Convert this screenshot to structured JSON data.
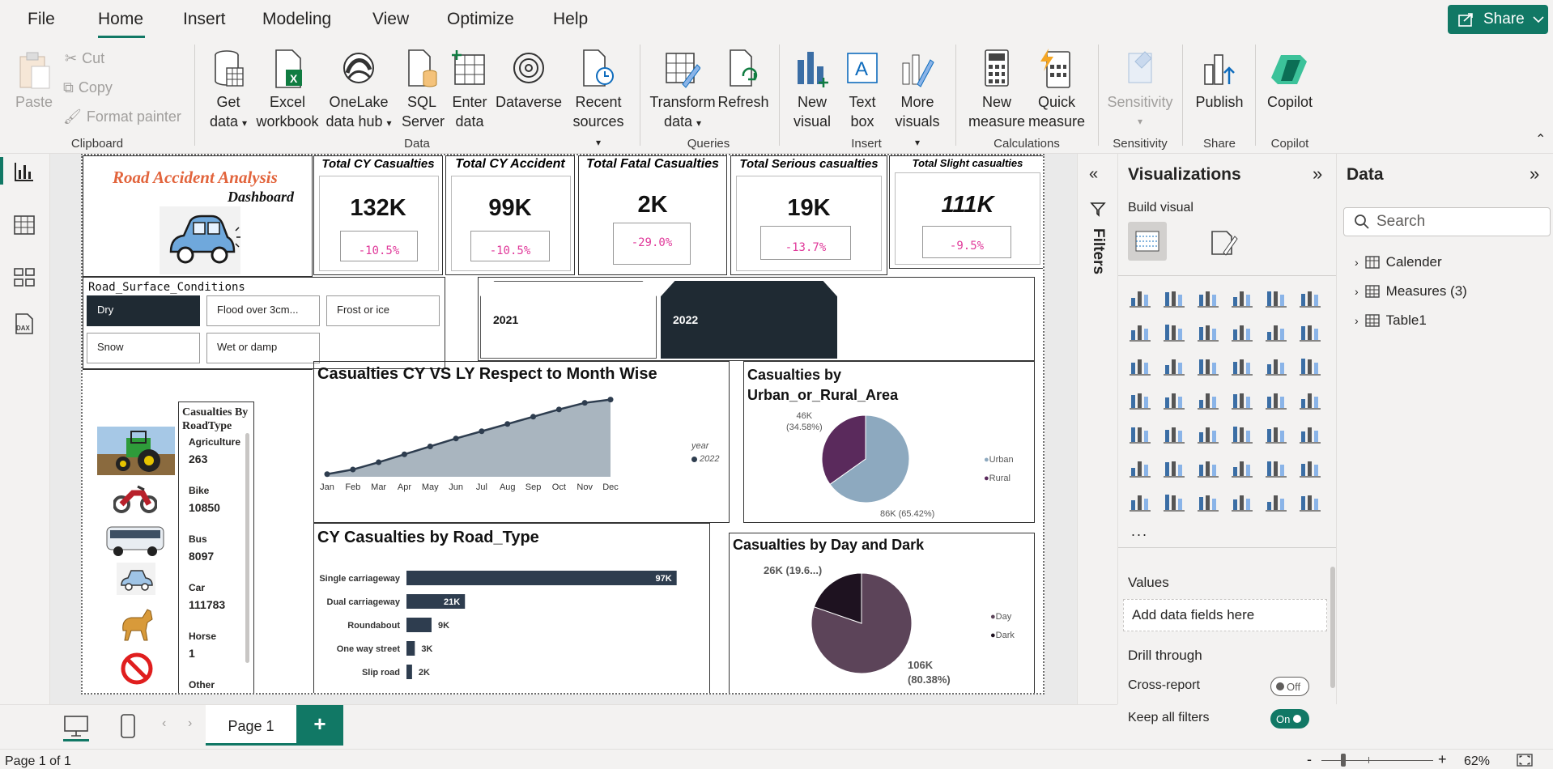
{
  "menu": {
    "file": "File",
    "home": "Home",
    "insert": "Insert",
    "modeling": "Modeling",
    "view": "View",
    "optimize": "Optimize",
    "help": "Help",
    "share": "Share"
  },
  "ribbon": {
    "paste": "Paste",
    "cut": "Cut",
    "copy": "Copy",
    "format_painter": "Format painter",
    "get_data": [
      "Get",
      "data"
    ],
    "excel": [
      "Excel",
      "workbook"
    ],
    "onelake": [
      "OneLake",
      "data hub"
    ],
    "sql": [
      "SQL",
      "Server"
    ],
    "enter_data": [
      "Enter",
      "data"
    ],
    "dataverse": "Dataverse",
    "recent_sources": [
      "Recent",
      "sources"
    ],
    "transform_data": [
      "Transform",
      "data"
    ],
    "refresh": "Refresh",
    "new_visual": [
      "New",
      "visual"
    ],
    "text_box": [
      "Text",
      "box"
    ],
    "more_visuals": [
      "More",
      "visuals"
    ],
    "new_measure": [
      "New",
      "measure"
    ],
    "quick_measure": [
      "Quick",
      "measure"
    ],
    "sensitivity": "Sensitivity",
    "publish": "Publish",
    "copilot": "Copilot",
    "groups": {
      "clipboard": "Clipboard",
      "data": "Data",
      "queries": "Queries",
      "insert": "Insert",
      "calculations": "Calculations",
      "sensitivity": "Sensitivity",
      "share": "Share",
      "copilot": "Copilot"
    }
  },
  "report": {
    "title_line1": "Road Accident Analysis",
    "title_line2": "Dashboard",
    "cards": [
      {
        "title": "Total CY Casualties",
        "value": "132K",
        "change": "-10.5%"
      },
      {
        "title": "Total CY Accident",
        "value": "99K",
        "change": "-10.5%"
      },
      {
        "title": "Total Fatal Casualties",
        "value": "2K",
        "change": "-29.0%"
      },
      {
        "title": "Total Serious casualties",
        "value": "19K",
        "change": "-13.7%"
      },
      {
        "title": "Total Slight casualties",
        "value": "111K",
        "change": "-9.5%"
      }
    ],
    "surface_title": "Road_Surface_Conditions",
    "surface_chips": [
      "Dry",
      "Flood over 3cm...",
      "Frost or ice",
      "Snow",
      "Wet or damp"
    ],
    "years": [
      "2021",
      "2022"
    ],
    "roadtype_list_title": [
      "Casualties By",
      "RoadType"
    ],
    "roadtype_list": [
      {
        "label": "Agriculture",
        "value": "263"
      },
      {
        "label": "Bike",
        "value": "10850"
      },
      {
        "label": "Bus",
        "value": "8097"
      },
      {
        "label": "Car",
        "value": "111783"
      },
      {
        "label": "Horse",
        "value": "1"
      },
      {
        "label": "Other",
        "value": ""
      }
    ],
    "line_title": "Casualties CY VS LY Respect to Month Wise",
    "line_legend_title": "year",
    "line_legend_item": "2022",
    "pie1_title": [
      "Casualties by",
      "Urban_or_Rural_Area"
    ],
    "pie1_labels": {
      "rural": [
        "46K",
        "(34.58%)"
      ],
      "urban": "86K (65.42%)"
    },
    "pie1_legend": [
      "Urban",
      "Rural"
    ],
    "bar_title": "CY Casualties by Road_Type",
    "pie2_title": "Casualties by Day and Dark",
    "pie2_labels": {
      "dark": "26K (19.6...)",
      "day": [
        "106K",
        "(80.38%)"
      ]
    },
    "pie2_legend": [
      "Day",
      "Dark"
    ]
  },
  "filters_label": "Filters",
  "viz": {
    "title": "Visualizations",
    "build_visual": "Build visual",
    "values_label": "Values",
    "values_placeholder": "Add data fields here",
    "drill_through": "Drill through",
    "cross_report": "Cross-report",
    "cross_report_state": "Off",
    "keep_filters": "Keep all filters",
    "keep_filters_state": "On",
    "more": "..."
  },
  "data_pane": {
    "title": "Data",
    "search_placeholder": "Search",
    "items": [
      "Calender",
      "Measures (3)",
      "Table1"
    ]
  },
  "pages": {
    "tab": "Page 1",
    "add": "+"
  },
  "status": {
    "page_info": "Page 1 of 1",
    "zoom": "62%",
    "minus": "-",
    "plus": "+"
  },
  "chart_data": [
    {
      "type": "area",
      "title": "Casualties CY VS LY Respect to Month Wise",
      "categories": [
        "Jan",
        "Feb",
        "Mar",
        "Apr",
        "May",
        "Jun",
        "Jul",
        "Aug",
        "Sep",
        "Oct",
        "Nov",
        "Dec"
      ],
      "series": [
        {
          "name": "2022",
          "values": [
            4,
            11,
            22,
            34,
            46,
            58,
            69,
            80,
            91,
            102,
            112,
            117
          ]
        }
      ],
      "ylim": [
        0,
        130
      ],
      "color": "#2e3d4f",
      "fill": "#a9b5bf"
    },
    {
      "type": "pie",
      "title": "Casualties by Urban_or_Rural_Area",
      "categories": [
        "Urban",
        "Rural"
      ],
      "values": [
        86,
        46
      ],
      "colors": [
        "#8da9bf",
        "#5a2a5c"
      ]
    },
    {
      "type": "bar",
      "title": "CY Casualties by Road_Type",
      "categories": [
        "Single carriageway",
        "Dual carriageway",
        "Roundabout",
        "One way street",
        "Slip road"
      ],
      "values": [
        97,
        21,
        9,
        3,
        2
      ],
      "value_labels": [
        "97K",
        "21K",
        "9K",
        "3K",
        "2K"
      ],
      "color": "#2e3d4f",
      "xlim": [
        0,
        100
      ]
    },
    {
      "type": "pie",
      "title": "Casualties by Day and Dark",
      "categories": [
        "Day",
        "Dark"
      ],
      "values": [
        106,
        26
      ],
      "colors": [
        "#5c4459",
        "#1e1220"
      ]
    }
  ]
}
